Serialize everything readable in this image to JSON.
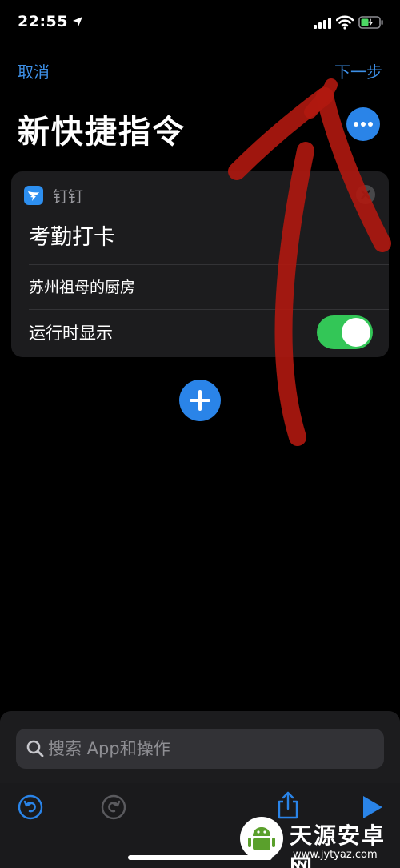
{
  "status_bar": {
    "time": "22:55"
  },
  "nav": {
    "cancel_label": "取消",
    "next_label": "下一步"
  },
  "page_title": "新快捷指令",
  "action_card": {
    "app_name": "钉钉",
    "action_title": "考勤打卡",
    "parameter": "苏州祖母的厨房",
    "toggle_label": "运行时显示",
    "toggle_on": true
  },
  "search": {
    "placeholder": "搜索 App和操作"
  },
  "watermark": {
    "title": "天源安卓网",
    "url": "www.jytyaz.com"
  },
  "colors": {
    "accent": "#2a84e8",
    "toggle_on": "#33c657",
    "annotation": "#b01810"
  },
  "icons": [
    "location-arrow-icon",
    "signal-icon",
    "wifi-icon",
    "battery-icon",
    "more-icon",
    "dingtalk-icon",
    "clear-icon",
    "plus-icon",
    "search-icon",
    "undo-icon",
    "redo-icon",
    "share-icon",
    "play-icon"
  ]
}
